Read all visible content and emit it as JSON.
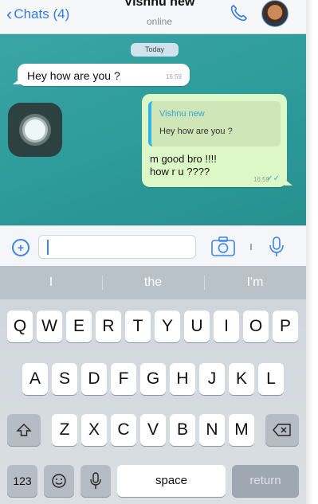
{
  "header": {
    "back_label": "Chats (4)",
    "contact_name": "Vishnu new",
    "status": "online"
  },
  "chat": {
    "date_label": "Today",
    "incoming": {
      "text": "Hey how are you ?",
      "time": "16:59"
    },
    "outgoing": {
      "quote_name": "Vishnu new",
      "quote_text": "Hey how are you ?",
      "lines": [
        "m good bro !!!!",
        "how r u ????"
      ],
      "time": "16:59"
    }
  },
  "input": {
    "plus": "+",
    "value": ""
  },
  "keyboard": {
    "suggestions": [
      "I",
      "the",
      "I'm"
    ],
    "row1": [
      "Q",
      "W",
      "E",
      "R",
      "T",
      "Y",
      "U",
      "I",
      "O",
      "P"
    ],
    "row2": [
      "A",
      "S",
      "D",
      "F",
      "G",
      "H",
      "J",
      "K",
      "L"
    ],
    "row3": [
      "Z",
      "X",
      "C",
      "V",
      "B",
      "N",
      "M"
    ],
    "numbers_label": "123",
    "space_label": "space",
    "return_label": "return"
  },
  "colors": {
    "accent": "#3c85e6",
    "chat_background": "#2d9c9b",
    "outgoing_bubble": "#dcf8c6",
    "read_ticks": "#41a8e8"
  },
  "icons": {
    "back": "chevron-left-icon",
    "call": "phone-icon",
    "attach": "plus-icon",
    "camera": "camera-icon",
    "mic": "microphone-icon",
    "shift": "shift-icon",
    "delete": "backspace-icon",
    "emoji": "emoji-icon",
    "dictation": "microphone-icon",
    "assistive": "assistive-touch-icon"
  }
}
